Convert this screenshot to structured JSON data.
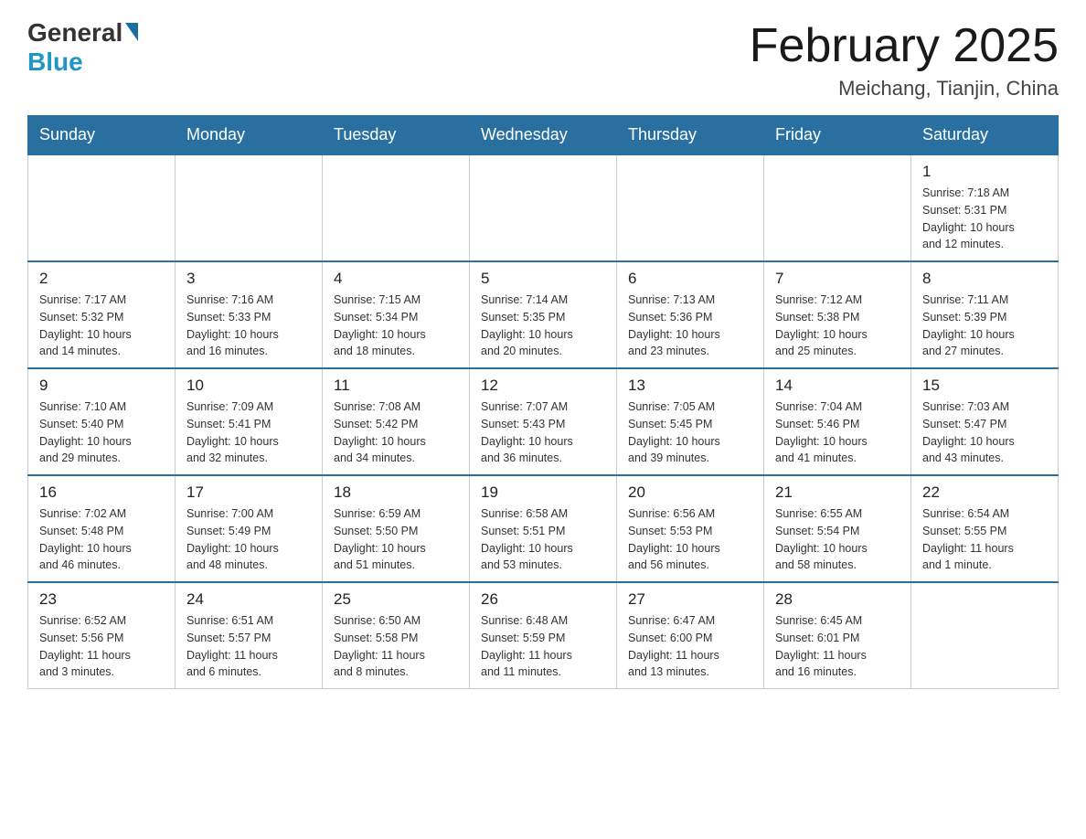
{
  "header": {
    "logo_general": "General",
    "logo_blue": "Blue",
    "title": "February 2025",
    "subtitle": "Meichang, Tianjin, China"
  },
  "days_of_week": [
    "Sunday",
    "Monday",
    "Tuesday",
    "Wednesday",
    "Thursday",
    "Friday",
    "Saturday"
  ],
  "weeks": [
    {
      "days": [
        {
          "num": "",
          "info": ""
        },
        {
          "num": "",
          "info": ""
        },
        {
          "num": "",
          "info": ""
        },
        {
          "num": "",
          "info": ""
        },
        {
          "num": "",
          "info": ""
        },
        {
          "num": "",
          "info": ""
        },
        {
          "num": "1",
          "info": "Sunrise: 7:18 AM\nSunset: 5:31 PM\nDaylight: 10 hours\nand 12 minutes."
        }
      ]
    },
    {
      "days": [
        {
          "num": "2",
          "info": "Sunrise: 7:17 AM\nSunset: 5:32 PM\nDaylight: 10 hours\nand 14 minutes."
        },
        {
          "num": "3",
          "info": "Sunrise: 7:16 AM\nSunset: 5:33 PM\nDaylight: 10 hours\nand 16 minutes."
        },
        {
          "num": "4",
          "info": "Sunrise: 7:15 AM\nSunset: 5:34 PM\nDaylight: 10 hours\nand 18 minutes."
        },
        {
          "num": "5",
          "info": "Sunrise: 7:14 AM\nSunset: 5:35 PM\nDaylight: 10 hours\nand 20 minutes."
        },
        {
          "num": "6",
          "info": "Sunrise: 7:13 AM\nSunset: 5:36 PM\nDaylight: 10 hours\nand 23 minutes."
        },
        {
          "num": "7",
          "info": "Sunrise: 7:12 AM\nSunset: 5:38 PM\nDaylight: 10 hours\nand 25 minutes."
        },
        {
          "num": "8",
          "info": "Sunrise: 7:11 AM\nSunset: 5:39 PM\nDaylight: 10 hours\nand 27 minutes."
        }
      ]
    },
    {
      "days": [
        {
          "num": "9",
          "info": "Sunrise: 7:10 AM\nSunset: 5:40 PM\nDaylight: 10 hours\nand 29 minutes."
        },
        {
          "num": "10",
          "info": "Sunrise: 7:09 AM\nSunset: 5:41 PM\nDaylight: 10 hours\nand 32 minutes."
        },
        {
          "num": "11",
          "info": "Sunrise: 7:08 AM\nSunset: 5:42 PM\nDaylight: 10 hours\nand 34 minutes."
        },
        {
          "num": "12",
          "info": "Sunrise: 7:07 AM\nSunset: 5:43 PM\nDaylight: 10 hours\nand 36 minutes."
        },
        {
          "num": "13",
          "info": "Sunrise: 7:05 AM\nSunset: 5:45 PM\nDaylight: 10 hours\nand 39 minutes."
        },
        {
          "num": "14",
          "info": "Sunrise: 7:04 AM\nSunset: 5:46 PM\nDaylight: 10 hours\nand 41 minutes."
        },
        {
          "num": "15",
          "info": "Sunrise: 7:03 AM\nSunset: 5:47 PM\nDaylight: 10 hours\nand 43 minutes."
        }
      ]
    },
    {
      "days": [
        {
          "num": "16",
          "info": "Sunrise: 7:02 AM\nSunset: 5:48 PM\nDaylight: 10 hours\nand 46 minutes."
        },
        {
          "num": "17",
          "info": "Sunrise: 7:00 AM\nSunset: 5:49 PM\nDaylight: 10 hours\nand 48 minutes."
        },
        {
          "num": "18",
          "info": "Sunrise: 6:59 AM\nSunset: 5:50 PM\nDaylight: 10 hours\nand 51 minutes."
        },
        {
          "num": "19",
          "info": "Sunrise: 6:58 AM\nSunset: 5:51 PM\nDaylight: 10 hours\nand 53 minutes."
        },
        {
          "num": "20",
          "info": "Sunrise: 6:56 AM\nSunset: 5:53 PM\nDaylight: 10 hours\nand 56 minutes."
        },
        {
          "num": "21",
          "info": "Sunrise: 6:55 AM\nSunset: 5:54 PM\nDaylight: 10 hours\nand 58 minutes."
        },
        {
          "num": "22",
          "info": "Sunrise: 6:54 AM\nSunset: 5:55 PM\nDaylight: 11 hours\nand 1 minute."
        }
      ]
    },
    {
      "days": [
        {
          "num": "23",
          "info": "Sunrise: 6:52 AM\nSunset: 5:56 PM\nDaylight: 11 hours\nand 3 minutes."
        },
        {
          "num": "24",
          "info": "Sunrise: 6:51 AM\nSunset: 5:57 PM\nDaylight: 11 hours\nand 6 minutes."
        },
        {
          "num": "25",
          "info": "Sunrise: 6:50 AM\nSunset: 5:58 PM\nDaylight: 11 hours\nand 8 minutes."
        },
        {
          "num": "26",
          "info": "Sunrise: 6:48 AM\nSunset: 5:59 PM\nDaylight: 11 hours\nand 11 minutes."
        },
        {
          "num": "27",
          "info": "Sunrise: 6:47 AM\nSunset: 6:00 PM\nDaylight: 11 hours\nand 13 minutes."
        },
        {
          "num": "28",
          "info": "Sunrise: 6:45 AM\nSunset: 6:01 PM\nDaylight: 11 hours\nand 16 minutes."
        },
        {
          "num": "",
          "info": ""
        }
      ]
    }
  ]
}
